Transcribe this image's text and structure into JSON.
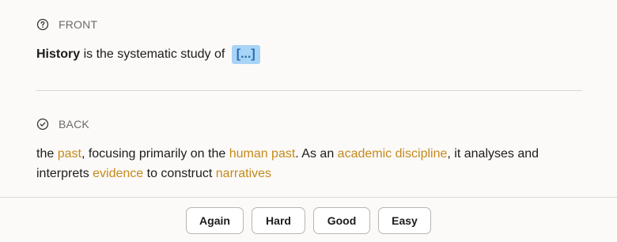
{
  "front": {
    "header_label": "FRONT",
    "icon": "help-circle-icon",
    "term": "History",
    "text": " is the systematic study of",
    "cloze": "[...]"
  },
  "back": {
    "header_label": "BACK",
    "icon": "check-circle-icon",
    "segments": [
      {
        "text": "the ",
        "highlight": false
      },
      {
        "text": "past",
        "highlight": true
      },
      {
        "text": ", focusing primarily on the ",
        "highlight": false
      },
      {
        "text": "human past",
        "highlight": true
      },
      {
        "text": ". As an ",
        "highlight": false
      },
      {
        "text": "academic discipline",
        "highlight": true
      },
      {
        "text": ", it analyses and interprets ",
        "highlight": false
      },
      {
        "text": "evidence",
        "highlight": true
      },
      {
        "text": " to construct ",
        "highlight": false
      },
      {
        "text": "narratives",
        "highlight": true
      }
    ]
  },
  "buttons": {
    "again": "Again",
    "hard": "Hard",
    "good": "Good",
    "easy": "Easy"
  },
  "colors": {
    "highlight": "#c38a1c",
    "cloze_bg": "#a8d4f5",
    "cloze_text": "#2b6cb0"
  }
}
